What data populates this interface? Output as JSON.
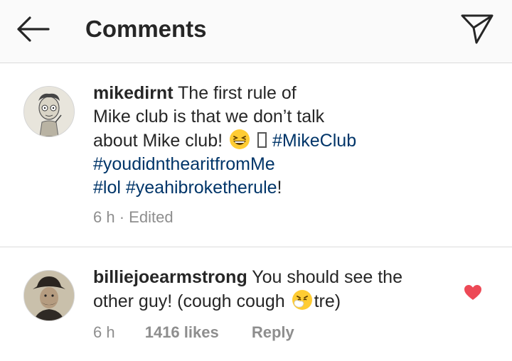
{
  "header": {
    "title": "Comments"
  },
  "comments": [
    {
      "username": "mikedirnt",
      "text_line1": " The first rule of",
      "text_line2": "Mike club is that we don’t talk",
      "text_line3_pre": "about Mike club! ",
      "hashtag1": "#MikeClub",
      "hashtag2": "#youdidnthearitfromMe",
      "hashtag3": "#lol",
      "hashtag4": "#yeahibroketherule",
      "text_end": "!",
      "time": "6 h",
      "separator": "·",
      "edited": "Edited"
    },
    {
      "username": "billiejoearmstrong",
      "text_line1": " You should see the",
      "text_line2_pre": "other guy! (cough cough ",
      "text_line2_post": "tre)",
      "time": "6 h",
      "likes": "1416 likes",
      "reply": "Reply",
      "liked": true
    }
  ],
  "colors": {
    "hashtag": "#003569",
    "meta": "#8e8e8e",
    "heart": "#ed4956",
    "divider": "#dbdbdb"
  },
  "icons": {
    "back": "arrow-left-icon",
    "send": "paper-plane-icon",
    "emoji1": "grinning-squinting-face-icon",
    "emoji2": "sneezing-face-icon",
    "heart": "heart-icon"
  }
}
